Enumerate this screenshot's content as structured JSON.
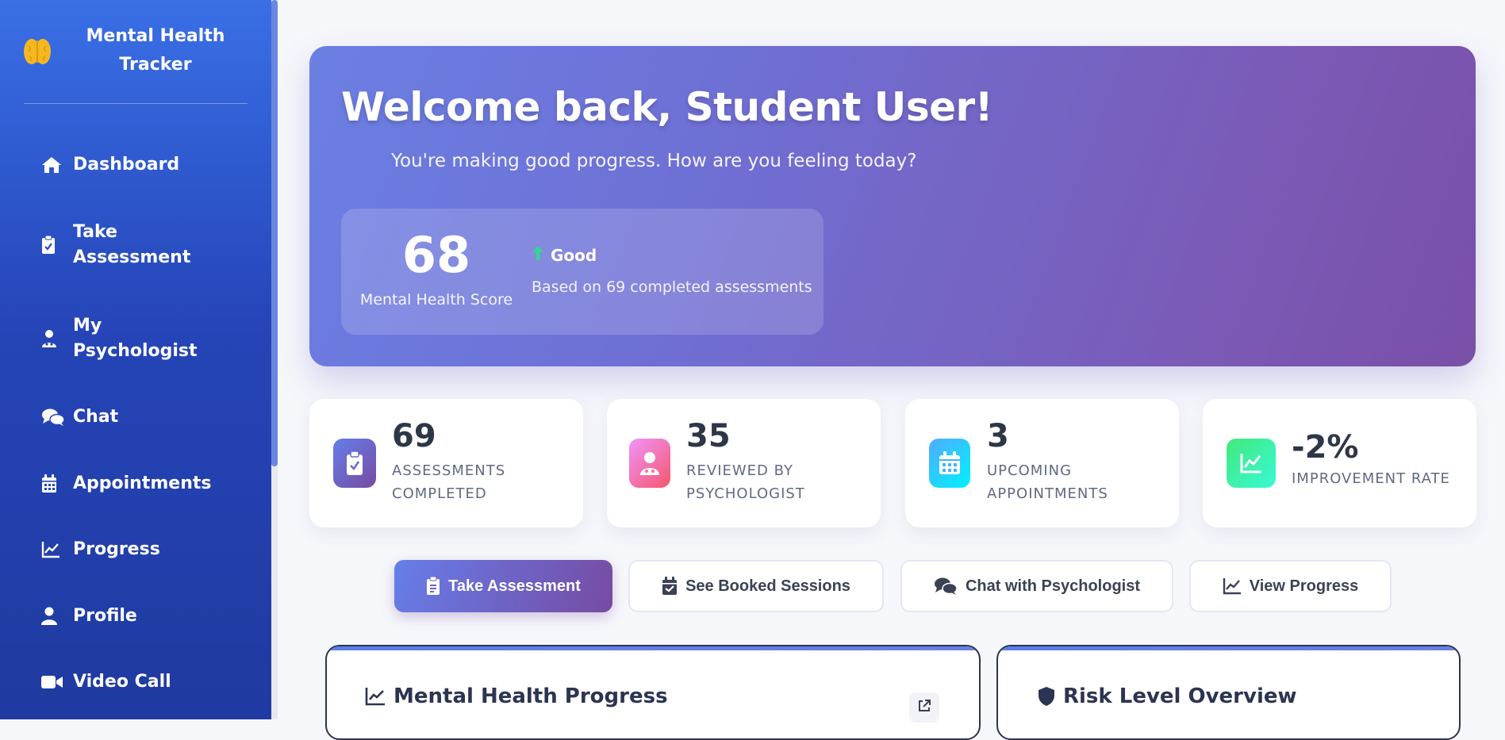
{
  "app": {
    "title": "Mental Health Tracker"
  },
  "sidebar": {
    "items": [
      {
        "label": "Dashboard",
        "icon": "home-icon"
      },
      {
        "label": "Take Assessment",
        "icon": "clipboard-check-icon"
      },
      {
        "label": "My Psychologist",
        "icon": "user-doctor-icon"
      },
      {
        "label": "Chat",
        "icon": "comments-icon"
      },
      {
        "label": "Appointments",
        "icon": "calendar-icon"
      },
      {
        "label": "Progress",
        "icon": "chart-line-icon"
      },
      {
        "label": "Profile",
        "icon": "user-icon"
      },
      {
        "label": "Video Call",
        "icon": "video-icon"
      }
    ]
  },
  "hero": {
    "title": "Welcome back, Student User!",
    "subtitle": "You're making good progress. How are you feeling today?",
    "score": {
      "value": "68",
      "label": "Mental Health Score",
      "status": "Good",
      "basis": "Based on 69 completed assessments"
    }
  },
  "stats": [
    {
      "value": "69",
      "label": "Assessments Completed",
      "icon": "clipboard-check-icon",
      "color_from": "#667eea",
      "color_to": "#764ba2"
    },
    {
      "value": "35",
      "label": "Reviewed by Psychologist",
      "icon": "user-doctor-icon",
      "color_from": "#f093fb",
      "color_to": "#f5576c"
    },
    {
      "value": "3",
      "label": "Upcoming Appointments",
      "icon": "calendar-icon",
      "color_from": "#4facfe",
      "color_to": "#00f2fe"
    },
    {
      "value": "-2%",
      "label": "Improvement Rate",
      "icon": "chart-line-icon",
      "color_from": "#43e97b",
      "color_to": "#38f9d7"
    }
  ],
  "actions": [
    {
      "label": "Take Assessment",
      "icon": "clipboard-icon",
      "style": "primary"
    },
    {
      "label": "See Booked Sessions",
      "icon": "calendar-icon",
      "style": "secondary"
    },
    {
      "label": "Chat with Psychologist",
      "icon": "comments-icon",
      "style": "secondary"
    },
    {
      "label": "View Progress",
      "icon": "chart-line-icon",
      "style": "secondary"
    }
  ],
  "panels": [
    {
      "title": "Mental Health Progress",
      "icon": "chart-line-icon"
    },
    {
      "title": "Risk Level Overview",
      "icon": "shield-icon"
    }
  ],
  "colors": {
    "sidebar_top": "#3a6fe6",
    "sidebar_bottom": "#1f3aa0",
    "hero_from": "#6b7fe3",
    "hero_to": "#7a4fa8",
    "status_up": "#34d399",
    "brain": "#f5b820"
  }
}
